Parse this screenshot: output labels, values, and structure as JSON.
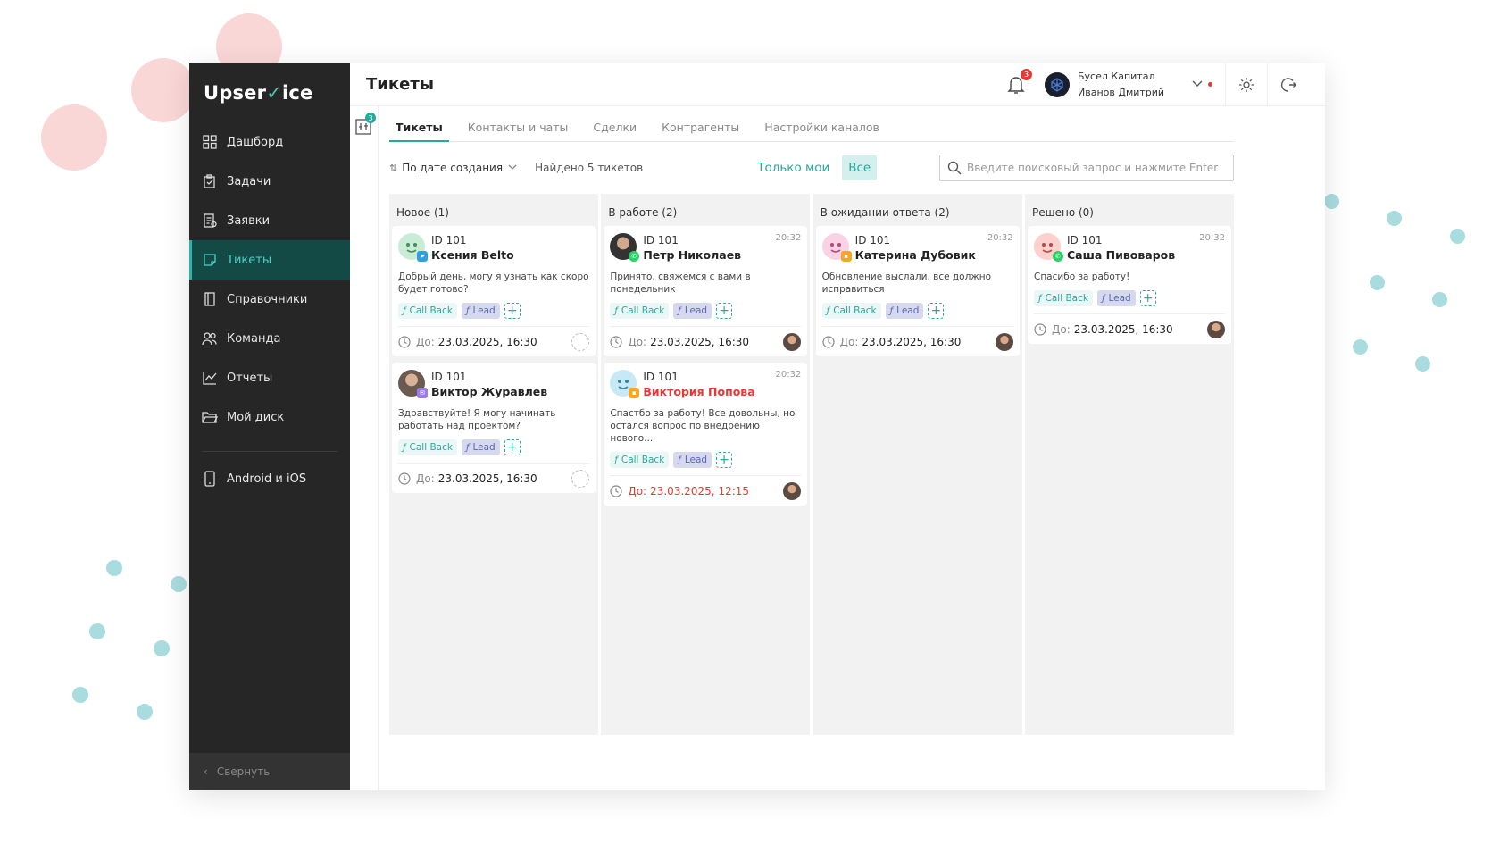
{
  "brand": {
    "logo_part1": "Upser",
    "logo_check": "✓",
    "logo_part2": "ice"
  },
  "sidebar": {
    "items": [
      {
        "label": "Дашборд",
        "icon": "grid-icon"
      },
      {
        "label": "Задачи",
        "icon": "clipboard-icon"
      },
      {
        "label": "Заявки",
        "icon": "request-icon"
      },
      {
        "label": "Тикеты",
        "icon": "ticket-icon",
        "active": true
      },
      {
        "label": "Справочники",
        "icon": "book-icon"
      },
      {
        "label": "Команда",
        "icon": "team-icon"
      },
      {
        "label": "Отчеты",
        "icon": "chart-icon"
      },
      {
        "label": "Мой диск",
        "icon": "folder-icon"
      }
    ],
    "mobile": {
      "label": "Android и iOS",
      "icon": "phone-icon"
    },
    "collapse_label": "Свернуть"
  },
  "header": {
    "title": "Тикеты",
    "notifications_count": "3",
    "company": "Бусел Капитал",
    "user": "Иванов Дмитрий"
  },
  "strip": {
    "badge": "3"
  },
  "tabs": [
    "Тикеты",
    "Контакты и чаты",
    "Сделки",
    "Контрагенты",
    "Настройки каналов"
  ],
  "filters": {
    "sort_label": "По дате создания",
    "found": "Найдено 5 тикетов",
    "only_mine": "Только мои",
    "all": "Все",
    "search_placeholder": "Введите поисковый запрос и нажмите Enter"
  },
  "tag_labels": {
    "callback": "Call Back",
    "lead": "Lead",
    "due_prefix": "До:"
  },
  "columns": [
    {
      "title": "Новое (1)",
      "cards": [
        {
          "id": "ID 101",
          "name": "Ксения Belto",
          "time": "",
          "msg": "Добрый день, могу я узнать как скоро будет готово?",
          "due": "23.03.2025, 16:30"
        },
        {
          "id": "ID 101",
          "name": "Виктор Журавлев",
          "time": "",
          "msg": "Здравствуйте! Я могу начинать работать над проектом?",
          "due": "23.03.2025, 16:30"
        }
      ]
    },
    {
      "title": "В работе (2)",
      "cards": [
        {
          "id": "ID 101",
          "name": "Петр Николаев",
          "time": "20:32",
          "msg": "Принято, свяжемся с вами в понедельник",
          "due": "23.03.2025, 16:30"
        },
        {
          "id": "ID 101",
          "name": "Виктория Попова",
          "time": "20:32",
          "msg": "Спастбо за работу! Все довольны, но остался вопрос по внедрению нового...",
          "due": "23.03.2025, 12:15"
        }
      ]
    },
    {
      "title": "В ожидании ответа (2)",
      "cards": [
        {
          "id": "ID 101",
          "name": "Катерина Дубовик",
          "time": "20:32",
          "msg": "Обновление выслали, все должно исправиться",
          "due": "23.03.2025, 16:30"
        }
      ]
    },
    {
      "title": "Решено (0)",
      "cards": [
        {
          "id": "ID 101",
          "name": "Саша Пивоваров",
          "time": "20:32",
          "msg": "Спасибо за работу!",
          "due": "23.03.2025, 16:30"
        }
      ]
    }
  ],
  "colors": {
    "accent": "#27a99b",
    "sidebar": "#262626",
    "danger": "#e53935"
  }
}
